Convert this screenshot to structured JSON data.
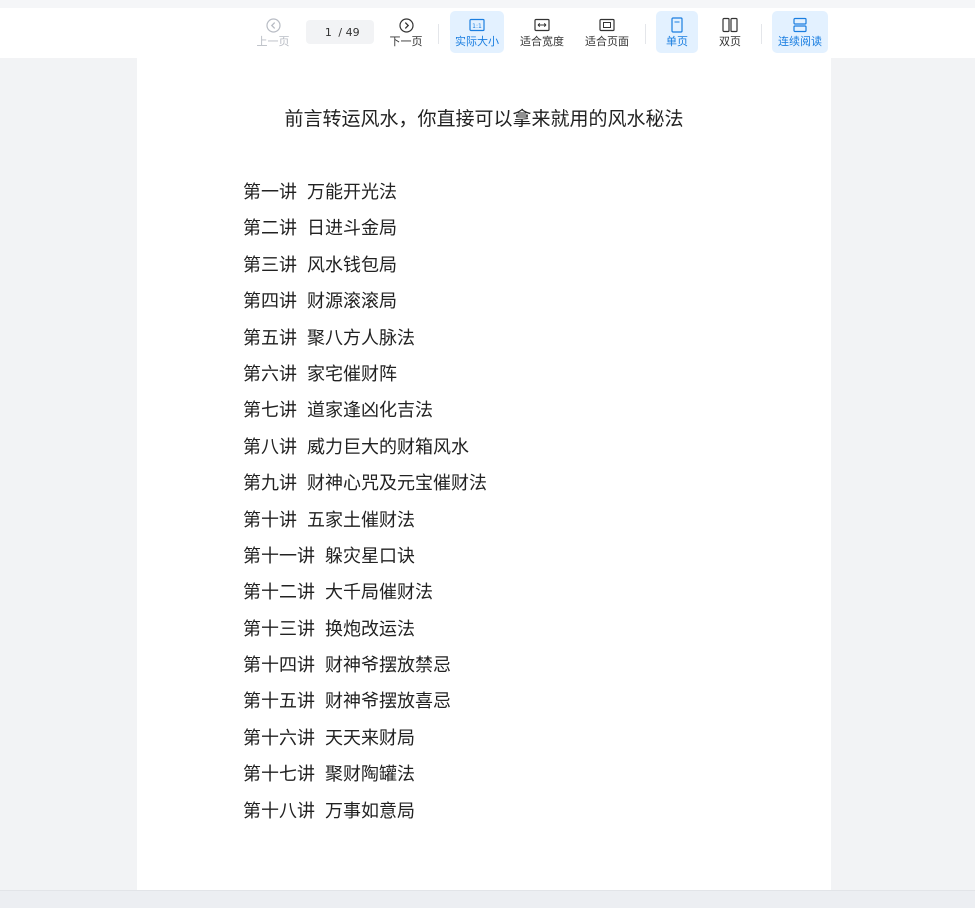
{
  "toolbar": {
    "prev_label": "上一页",
    "current_page": "1",
    "total_pages": "/ 49",
    "next_label": "下一页",
    "actual_size_label": "实际大小",
    "fit_width_label": "适合宽度",
    "fit_page_label": "适合页面",
    "single_page_label": "单页",
    "double_page_label": "双页",
    "continuous_label": "连续阅读",
    "accent_color": "#1a7ee0",
    "active_bg": "#e3f1ff"
  },
  "document": {
    "title": "前言转运风水，你直接可以拿来就用的风水秘法",
    "toc": [
      {
        "num": "第一讲",
        "title": "万能开光法"
      },
      {
        "num": "第二讲",
        "title": "日进斗金局"
      },
      {
        "num": "第三讲",
        "title": "风水钱包局"
      },
      {
        "num": "第四讲",
        "title": "财源滚滚局"
      },
      {
        "num": "第五讲",
        "title": "聚八方人脉法"
      },
      {
        "num": "第六讲",
        "title": "家宅催财阵"
      },
      {
        "num": "第七讲",
        "title": "道家逢凶化吉法"
      },
      {
        "num": "第八讲",
        "title": "威力巨大的财箱风水"
      },
      {
        "num": "第九讲",
        "title": "财神心咒及元宝催财法"
      },
      {
        "num": "第十讲",
        "title": "五家土催财法"
      },
      {
        "num": "第十一讲",
        "title": "躲灾星口诀"
      },
      {
        "num": "第十二讲",
        "title": "大千局催财法"
      },
      {
        "num": "第十三讲",
        "title": "换炮改运法"
      },
      {
        "num": "第十四讲",
        "title": "财神爷摆放禁忌"
      },
      {
        "num": "第十五讲",
        "title": "财神爷摆放喜忌"
      },
      {
        "num": "第十六讲",
        "title": "天天来财局"
      },
      {
        "num": "第十七讲",
        "title": "聚财陶罐法"
      },
      {
        "num": "第十八讲",
        "title": "万事如意局"
      }
    ]
  }
}
